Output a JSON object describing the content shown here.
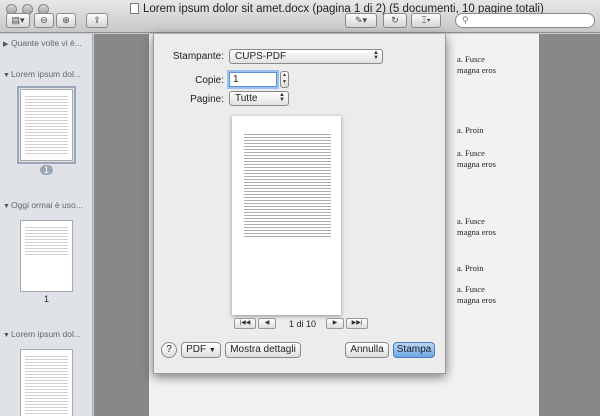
{
  "window": {
    "title": "Lorem ipsum dolor sit amet.docx (pagina 1 di 2) (5 documenti, 10 pagine totali)"
  },
  "toolbar": {
    "sidebar_button_icon": "sidebar-icon",
    "zoom_out_icon": "zoom-out-icon",
    "zoom_in_icon": "zoom-in-icon",
    "share_icon": "share-icon",
    "annotate_icon": "pen-icon",
    "rotate_icon": "rotate-icon",
    "select_icon": "select-icon",
    "search_placeholder": ""
  },
  "sidebar": {
    "groups": [
      {
        "label": "Quante volte vi è...",
        "expanded": false
      },
      {
        "label": "Lorem ipsum dol...",
        "expanded": true,
        "page": "1"
      },
      {
        "label": "Oggi ormai è uso...",
        "expanded": true,
        "page": "1"
      },
      {
        "label": "Lorem ipsum dol...",
        "expanded": true
      }
    ]
  },
  "document": {
    "paragraphs_right": [
      "a. Fusce",
      "magna eros",
      "a. Proin",
      "a. Fusce",
      "magna eros",
      "a. Fusce",
      "magna eros",
      "a. Proin",
      "a. Fusce",
      "magna eros"
    ]
  },
  "print": {
    "printer_label": "Stampante:",
    "printer_value": "CUPS-PDF",
    "copies_label": "Copie:",
    "copies_value": "1",
    "pages_label": "Pagine:",
    "pages_value": "Tutte",
    "page_info": "1 di 10",
    "help_label": "?",
    "pdf_label": "PDF",
    "details_label": "Mostra dettagli",
    "cancel_label": "Annulla",
    "print_label": "Stampa"
  },
  "colors": {
    "accent": "#6da7e6",
    "sidebar_bg": "#dfe3e8"
  }
}
